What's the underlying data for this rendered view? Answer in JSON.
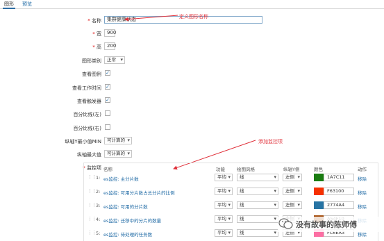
{
  "tabs": [
    {
      "label": "图形",
      "active": true
    },
    {
      "label": "预览",
      "active": false
    }
  ],
  "form": {
    "name_label": "名称",
    "name_value": "集群健康状态",
    "width_label": "宽",
    "width_value": "900",
    "height_label": "高",
    "height_value": "200",
    "graph_type_label": "图形类别",
    "graph_type_value": "正常",
    "show_legend_label": "查看图例",
    "show_legend_checked": true,
    "show_work_period_label": "查看工作时间",
    "show_work_period_checked": true,
    "show_triggers_label": "查看触发器",
    "show_triggers_checked": true,
    "percentile_left_label": "百分比线(左)",
    "percentile_left_checked": false,
    "percentile_right_label": "百分比线(右)",
    "percentile_right_checked": false,
    "ymin_label": "纵轴Y最小值MIN",
    "ymin_value": "可计算的",
    "ymax_label": "纵轴最大值",
    "ymax_value": "可计算的",
    "items_label": "监控项"
  },
  "annotations": {
    "name_note": "定义图形名称",
    "items_note": "添加监控项"
  },
  "items_table": {
    "headers": {
      "name": "名称",
      "function": "功能",
      "draw_style": "绘图风格",
      "y_axis": "纵轴Y侧",
      "color": "颜色",
      "action": "动作"
    },
    "rows": [
      {
        "num": "1:",
        "name": "es监控: 主分片数",
        "function": "平均",
        "draw_style": "线",
        "y_axis": "左侧",
        "color": "1A7C11",
        "color_hex": "#1A7C11",
        "action": "移除"
      },
      {
        "num": "2:",
        "name": "es监控: 可用分片数占总分片的比例",
        "function": "平均",
        "draw_style": "线",
        "y_axis": "左侧",
        "color": "F63100",
        "color_hex": "#F63100",
        "action": "移除"
      },
      {
        "num": "3:",
        "name": "es监控: 可用的分片数",
        "function": "平均",
        "draw_style": "线",
        "y_axis": "左侧",
        "color": "2774A4",
        "color_hex": "#2774A4",
        "action": "移除"
      },
      {
        "num": "4:",
        "name": "es监控: 迁移中的分片的数量",
        "function": "平均",
        "draw_style": "线",
        "y_axis": "左侧",
        "color": "A54F10",
        "color_hex": "#A54F10",
        "action": "移除"
      },
      {
        "num": "5:",
        "name": "es监控: 待处理的任务数",
        "function": "平均",
        "draw_style": "线",
        "y_axis": "左侧",
        "color": "FC6EA3",
        "color_hex": "#FC6EA3",
        "action": "移除"
      }
    ]
  },
  "watermark": {
    "text": "没有故事的陈师傅"
  },
  "colors": {
    "accent": "#1f6aa5",
    "annotation": "#e0303a"
  }
}
